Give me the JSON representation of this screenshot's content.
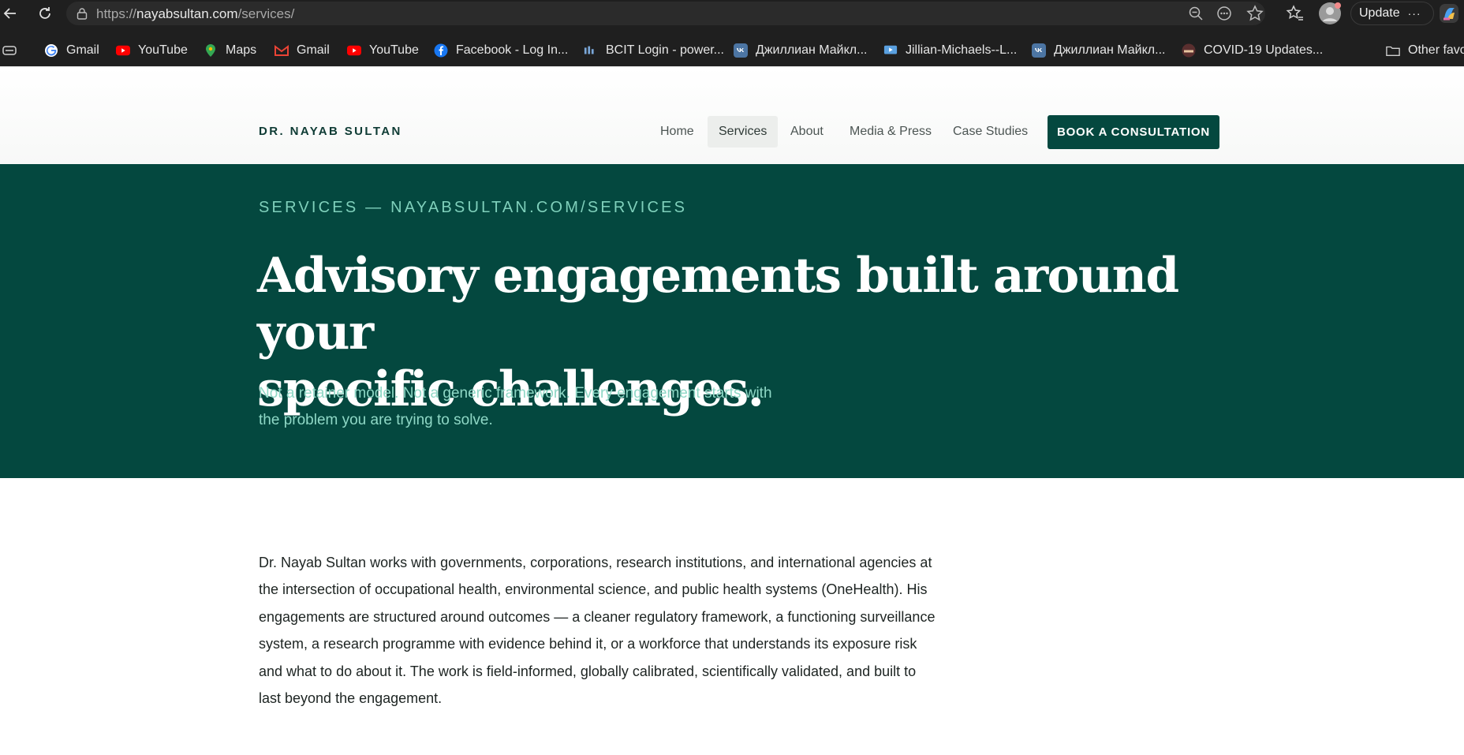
{
  "browser": {
    "url_prefix": "https://",
    "url_host": "nayabsultan.com",
    "url_path": "/services/",
    "update_label": "Update",
    "more_label": "···"
  },
  "bookmarks": [
    {
      "label": "Gmail",
      "icon": "google-icon"
    },
    {
      "label": "YouTube",
      "icon": "youtube-icon"
    },
    {
      "label": "Maps",
      "icon": "maps-icon"
    },
    {
      "label": "Gmail",
      "icon": "gmail-icon"
    },
    {
      "label": "YouTube",
      "icon": "youtube-icon"
    },
    {
      "label": "Facebook - Log In...",
      "icon": "facebook-icon"
    },
    {
      "label": "BCIT Login - power...",
      "icon": "bcit-icon"
    },
    {
      "label": "Джиллиан Майкл...",
      "icon": "vk-icon"
    },
    {
      "label": "Jillian-Michaels--L...",
      "icon": "video-icon"
    },
    {
      "label": "Джиллиан Майкл...",
      "icon": "vk-icon"
    },
    {
      "label": "COVID-19 Updates...",
      "icon": "site-icon"
    },
    {
      "label": "Other favo",
      "icon": "folder-icon"
    }
  ],
  "site": {
    "brand": "DR. NAYAB SULTAN",
    "nav": [
      "Home",
      "Services",
      "About",
      "Media & Press",
      "Case Studies"
    ],
    "active_nav": "Services",
    "cta": "BOOK A CONSULTATION"
  },
  "hero": {
    "eyebrow": "SERVICES — NAYABSULTAN.COM/SERVICES",
    "title_line1": "Advisory engagements built around your",
    "title_line2": "specific challenges.",
    "subtitle": "Not a retainer model. Not a generic framework. Every engagement starts with the problem you are trying to solve."
  },
  "intro": {
    "paragraph": "Dr. Nayab Sultan works with governments, corporations, research institutions, and international agencies at the intersection of occupational health, environmental science, and public health systems (OneHealth). His engagements are structured around outcomes — a cleaner regulatory framework, a functioning surveillance system, a research programme with evidence behind it, or a workforce that understands its exposure risk and what to do about it. The work is field-informed, globally calibrated, scientifically validated, and built to last beyond the engagement."
  },
  "colors": {
    "brand_green": "#04483f",
    "accent_mint": "#7fd0bb"
  }
}
